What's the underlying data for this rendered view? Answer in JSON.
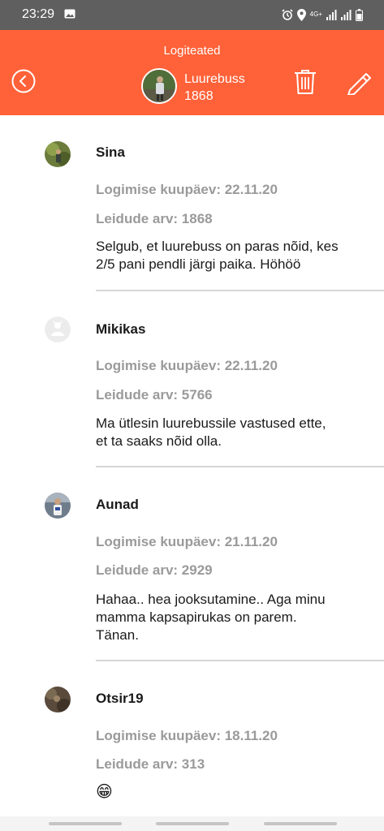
{
  "status_bar": {
    "time": "23:29",
    "network": "4G+",
    "icons": [
      "gallery-icon",
      "alarm-icon",
      "location-icon",
      "signal-icon",
      "signal-icon",
      "battery-icon"
    ]
  },
  "header": {
    "title": "Logiteated",
    "cache_name": "Luurebuss",
    "cache_count": "1868",
    "color": "#ff6138",
    "icons": [
      "back-circle-icon",
      "trash-icon",
      "pencil-icon"
    ]
  },
  "logs": [
    {
      "username": "Sina",
      "date": "Logimise kuupäev: 22.11.20",
      "finds": "Leidude arv: 1868",
      "text_lines": [
        "Selgub, et luurebuss on paras nõid, kes",
        "2/5 pani pendli järgi paika. Höhöö"
      ]
    },
    {
      "username": "Mikikas",
      "date": "Logimise kuupäev: 22.11.20",
      "finds": "Leidude arv: 5766",
      "text_lines": [
        "Ma ütlesin luurebussile vastused ette,",
        "et ta saaks nõid olla."
      ]
    },
    {
      "username": "Aunad",
      "date": "Logimise kuupäev: 21.11.20",
      "finds": "Leidude arv: 2929",
      "text_lines": [
        "Hahaa.. hea jooksutamine.. Aga minu",
        "mamma kapsapirukas on parem.",
        "Tänan."
      ]
    },
    {
      "username": "Otsir19",
      "date": "Logimise kuupäev: 18.11.20",
      "finds": "Leidude arv: 313",
      "text_lines": [
        "😁"
      ]
    }
  ]
}
